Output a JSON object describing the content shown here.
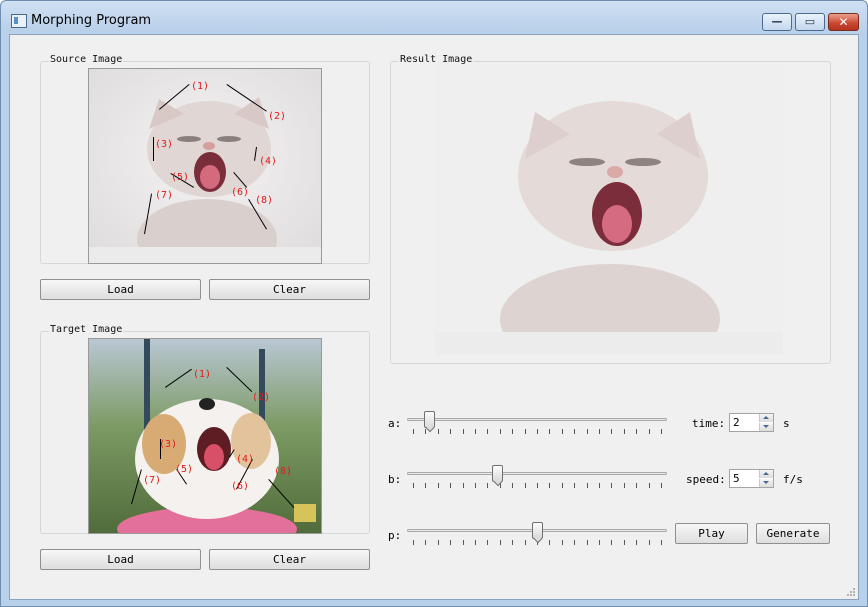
{
  "window": {
    "title": "Morphing Program",
    "min_glyph": "—",
    "max_glyph": "▭",
    "close_glyph": "✕"
  },
  "source": {
    "group_title": "Source Image",
    "load_label": "Load",
    "clear_label": "Clear",
    "markers": [
      "(1)",
      "(2)",
      "(3)",
      "(4)",
      "(5)",
      "(6)",
      "(7)",
      "(8)"
    ]
  },
  "target": {
    "group_title": "Target Image",
    "load_label": "Load",
    "clear_label": "Clear",
    "markers": [
      "(1)",
      "(2)",
      "(3)",
      "(4)",
      "(5)",
      "(6)",
      "(7)",
      "(8)"
    ]
  },
  "result": {
    "group_title": "Result Image"
  },
  "controls": {
    "a": {
      "label": "a:",
      "value": 0.07
    },
    "b": {
      "label": "b:",
      "value": 0.34
    },
    "p": {
      "label": "p:",
      "value": 0.5
    },
    "time": {
      "label": "time:",
      "value": "2",
      "unit": "s"
    },
    "speed": {
      "label": "speed:",
      "value": "5",
      "unit": "f/s"
    },
    "play_label": "Play",
    "generate_label": "Generate"
  },
  "colors": {
    "marker": "#e21a1a",
    "accent": "#3f6aa0"
  }
}
